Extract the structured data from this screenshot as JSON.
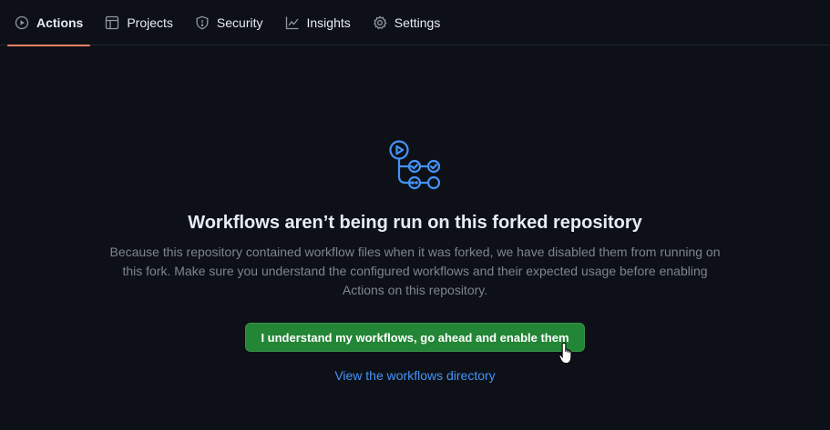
{
  "tabs": [
    {
      "label": "Actions",
      "icon": "play-icon",
      "active": true
    },
    {
      "label": "Projects",
      "icon": "table-icon",
      "active": false
    },
    {
      "label": "Security",
      "icon": "shield-icon",
      "active": false
    },
    {
      "label": "Insights",
      "icon": "graph-icon",
      "active": false
    },
    {
      "label": "Settings",
      "icon": "gear-icon",
      "active": false
    }
  ],
  "hero": {
    "icon": "workflow-icon",
    "title": "Workflows aren’t being run on this forked repository",
    "description": "Because this repository contained workflow files when it was forked, we have disabled them from running on this fork. Make sure you understand the configured workflows and their expected usage before enabling Actions on this repository.",
    "enable_button_label": "I understand my workflows, go ahead and enable them",
    "directory_link_label": "View the workflows directory"
  },
  "colors": {
    "background": "#0d1117",
    "active_tab_underline": "#f78166",
    "primary_button": "#238636",
    "link": "#4493f8",
    "icon_accent": "#4493f8"
  }
}
